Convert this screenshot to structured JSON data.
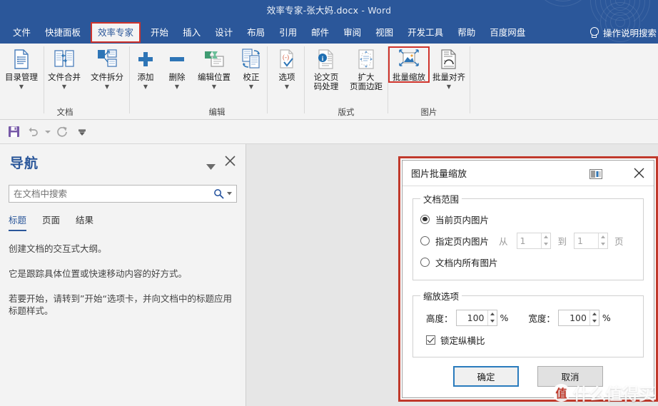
{
  "titlebar": {
    "document_title": "效率专家-张大妈.docx",
    "separator": "-",
    "app_name": "Word"
  },
  "tabs": [
    {
      "label": "文件",
      "active": false
    },
    {
      "label": "快捷面板",
      "active": false
    },
    {
      "label": "效率专家",
      "active": true
    },
    {
      "label": "开始",
      "active": false
    },
    {
      "label": "插入",
      "active": false
    },
    {
      "label": "设计",
      "active": false
    },
    {
      "label": "布局",
      "active": false
    },
    {
      "label": "引用",
      "active": false
    },
    {
      "label": "邮件",
      "active": false
    },
    {
      "label": "审阅",
      "active": false
    },
    {
      "label": "视图",
      "active": false
    },
    {
      "label": "开发工具",
      "active": false
    },
    {
      "label": "帮助",
      "active": false
    },
    {
      "label": "百度网盘",
      "active": false
    }
  ],
  "tell_me": {
    "label": "操作说明搜索",
    "icon": "lightbulb-icon"
  },
  "ribbon": {
    "groups": [
      {
        "name": "文档",
        "buttons": [
          {
            "label": "目录管理",
            "icon": "document-list-icon",
            "caret": true,
            "highlighted": false
          },
          {
            "label": "文件合并",
            "icon": "merge-documents-icon",
            "caret": true,
            "highlighted": false
          },
          {
            "label": "文件拆分",
            "icon": "split-document-icon",
            "caret": true,
            "highlighted": false
          }
        ]
      },
      {
        "name": "编辑",
        "buttons": [
          {
            "label": "添加",
            "icon": "plus-icon",
            "caret": true,
            "highlighted": false
          },
          {
            "label": "删除",
            "icon": "minus-icon",
            "caret": true,
            "highlighted": false
          },
          {
            "label": "编辑位置",
            "icon": "edit-position-icon",
            "caret": true,
            "highlighted": false
          },
          {
            "label": "校正",
            "icon": "proofread-icon",
            "caret": true,
            "highlighted": false
          },
          {
            "label": "选项",
            "icon": "options-check-icon",
            "caret": true,
            "highlighted": false
          }
        ]
      },
      {
        "name": "版式",
        "buttons": [
          {
            "label": "论文页\n码处理",
            "icon": "page-number-info-icon",
            "caret": false,
            "highlighted": false
          },
          {
            "label": "扩大\n页面边距",
            "icon": "expand-margin-icon",
            "caret": false,
            "highlighted": false
          }
        ]
      },
      {
        "name": "图片",
        "buttons": [
          {
            "label": "批量缩放",
            "icon": "batch-resize-image-icon",
            "caret": false,
            "highlighted": true
          },
          {
            "label": "批量对齐",
            "icon": "batch-align-image-icon",
            "caret": true,
            "highlighted": false
          }
        ]
      }
    ]
  },
  "quick_access": [
    {
      "name": "save-icon",
      "label": "保存"
    },
    {
      "name": "undo-icon",
      "label": "撤消"
    },
    {
      "name": "redo-icon",
      "label": "恢复"
    },
    {
      "name": "customize-qat-icon",
      "label": "自定义快速访问工具栏"
    }
  ],
  "navigation": {
    "title": "导航",
    "chevron_icon": "chevron-down-icon",
    "close_icon": "close-icon",
    "search": {
      "placeholder": "在文档中搜索",
      "value": "",
      "icon": "search-icon",
      "dropdown_icon": "caret-down-icon"
    },
    "tabs": [
      {
        "label": "标题",
        "active": true
      },
      {
        "label": "页面",
        "active": false
      },
      {
        "label": "结果",
        "active": false
      }
    ],
    "body_paragraphs": [
      "创建文档的交互式大纲。",
      "它是跟踪具体位置或快速移动内容的好方式。",
      "若要开始，请转到”开始“选项卡，并向文档中的标题应用标题样式。"
    ]
  },
  "dialog": {
    "title": "图片批量缩放",
    "title_icon": "window-pane-icon",
    "close_icon": "close-icon",
    "scope_group": {
      "legend": "文档范围",
      "options": [
        {
          "label": "当前页内图片",
          "selected": true
        },
        {
          "label": "指定页内图片",
          "selected": false
        },
        {
          "label": "文档内所有图片",
          "selected": false
        }
      ],
      "range": {
        "from_label": "从",
        "from_value": "1",
        "to_label": "到",
        "to_value": "1",
        "unit_label": "页"
      }
    },
    "scale_group": {
      "legend": "缩放选项",
      "height_label": "高度：",
      "height_value": "100",
      "height_unit": "%",
      "width_label": "宽度：",
      "width_value": "100",
      "width_unit": "%",
      "lock_label": "锁定纵横比",
      "lock_checked": true
    },
    "buttons": {
      "ok": "确定",
      "cancel": "取消"
    }
  },
  "watermark": {
    "badge": "值",
    "text": "什么值得买"
  },
  "colors": {
    "accent": "#2b579a",
    "highlight": "#d0342c",
    "dialog_border": "#c0392b",
    "nav_title": "#2b579a"
  }
}
